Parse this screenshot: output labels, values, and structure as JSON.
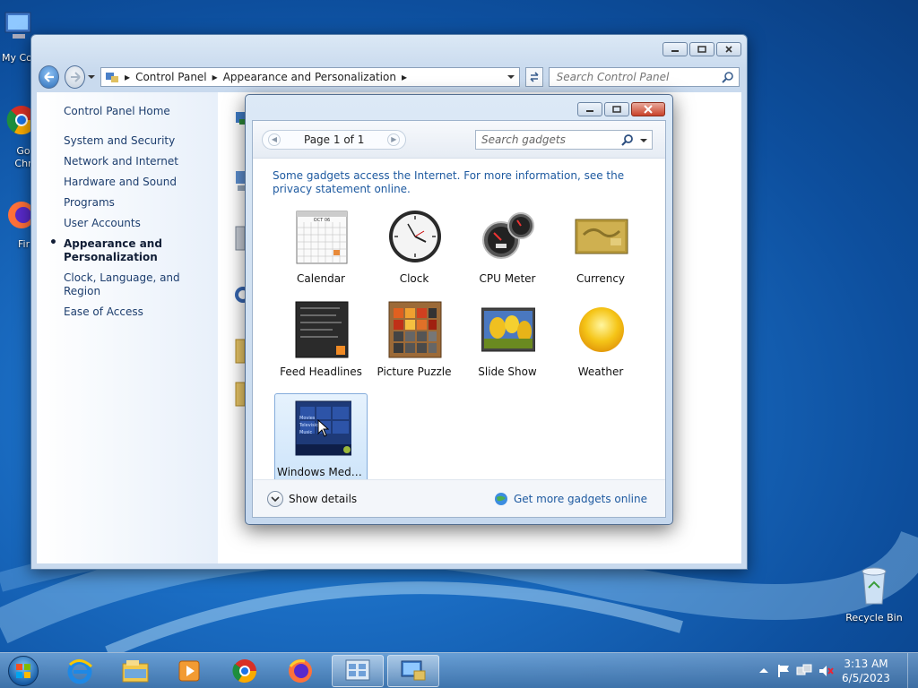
{
  "desktop": {
    "icons": [
      {
        "label": "My Co"
      },
      {
        "label": "Go Chr"
      },
      {
        "label": "Fir"
      },
      {
        "label": "Recycle Bin"
      }
    ]
  },
  "control_panel": {
    "breadcrumb": [
      "Control Panel",
      "Appearance and Personalization"
    ],
    "search_placeholder": "Search Control Panel",
    "sidebar": {
      "home": "Control Panel Home",
      "items": [
        "System and Security",
        "Network and Internet",
        "Hardware and Sound",
        "Programs",
        "User Accounts",
        "Appearance and Personalization",
        "Clock, Language, and Region",
        "Ease of Access"
      ],
      "active_index": 5
    }
  },
  "gadgets_dialog": {
    "pager_label": "Page 1 of 1",
    "search_placeholder": "Search gadgets",
    "note": "Some gadgets access the Internet.  For more information, see the privacy statement online.",
    "gadgets": [
      {
        "label": "Calendar",
        "icon": "calendar-icon"
      },
      {
        "label": "Clock",
        "icon": "clock-icon"
      },
      {
        "label": "CPU Meter",
        "icon": "cpu-meter-icon"
      },
      {
        "label": "Currency",
        "icon": "currency-icon"
      },
      {
        "label": "Feed Headlines",
        "icon": "feed-headlines-icon"
      },
      {
        "label": "Picture Puzzle",
        "icon": "picture-puzzle-icon"
      },
      {
        "label": "Slide Show",
        "icon": "slide-show-icon"
      },
      {
        "label": "Weather",
        "icon": "weather-icon"
      },
      {
        "label": "Windows Media...",
        "icon": "windows-media-center-icon"
      }
    ],
    "selected_gadget": 8,
    "show_details": "Show details",
    "get_more": "Get more gadgets online",
    "calendar_month": "OCT 06",
    "media_center_lines": [
      "Movies",
      "Television",
      "Music"
    ]
  },
  "taskbar": {
    "pinned": [
      "internet-explorer-icon",
      "file-explorer-icon",
      "media-player-icon",
      "chrome-icon",
      "firefox-icon",
      "gadgets-window-icon",
      "control-panel-icon"
    ],
    "time": "3:13 AM",
    "date": "6/5/2023"
  },
  "colors": {
    "link": "#1e5aa0",
    "sidebar_text": "#1d3e6e",
    "selection_bg": "#cde4fa"
  }
}
